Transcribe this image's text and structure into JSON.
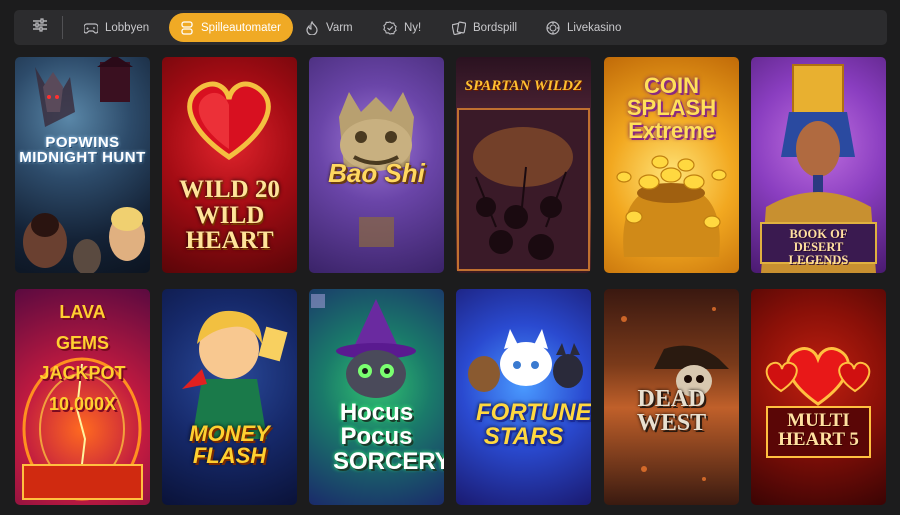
{
  "nav": {
    "filter_icon": "sliders-icon",
    "tabs": [
      {
        "label": "Lobbyen",
        "icon": "gamepad-icon",
        "active": false
      },
      {
        "label": "Spilleautomater",
        "icon": "slot-machine-icon",
        "active": true
      },
      {
        "label": "Varm",
        "icon": "flame-icon",
        "active": false
      },
      {
        "label": "Ny!",
        "icon": "new-badge-icon",
        "active": false
      },
      {
        "label": "Bordspill",
        "icon": "cards-icon",
        "active": false
      },
      {
        "label": "Livekasino",
        "icon": "chip-icon",
        "active": false
      }
    ],
    "accent": "#f0aa25"
  },
  "games": [
    {
      "title": "POPWINS MIDNIGHT HUNT"
    },
    {
      "title": "WILD 20 WILD HEART"
    },
    {
      "title": "Bao Shi"
    },
    {
      "title": "SPARTAN WILDZ"
    },
    {
      "title": "COIN SPLASH Extreme"
    },
    {
      "title": "BOOK OF DESERT LEGENDS"
    },
    {
      "title": "LAVA GEMS JACKPOT 10.000X"
    },
    {
      "title": "MONEY FLASH"
    },
    {
      "title": "Hocus Pocus SORCERY"
    },
    {
      "title": "FORTUNE STARS"
    },
    {
      "title": "DEAD WEST"
    },
    {
      "title": "MULTI HEART 5"
    }
  ]
}
